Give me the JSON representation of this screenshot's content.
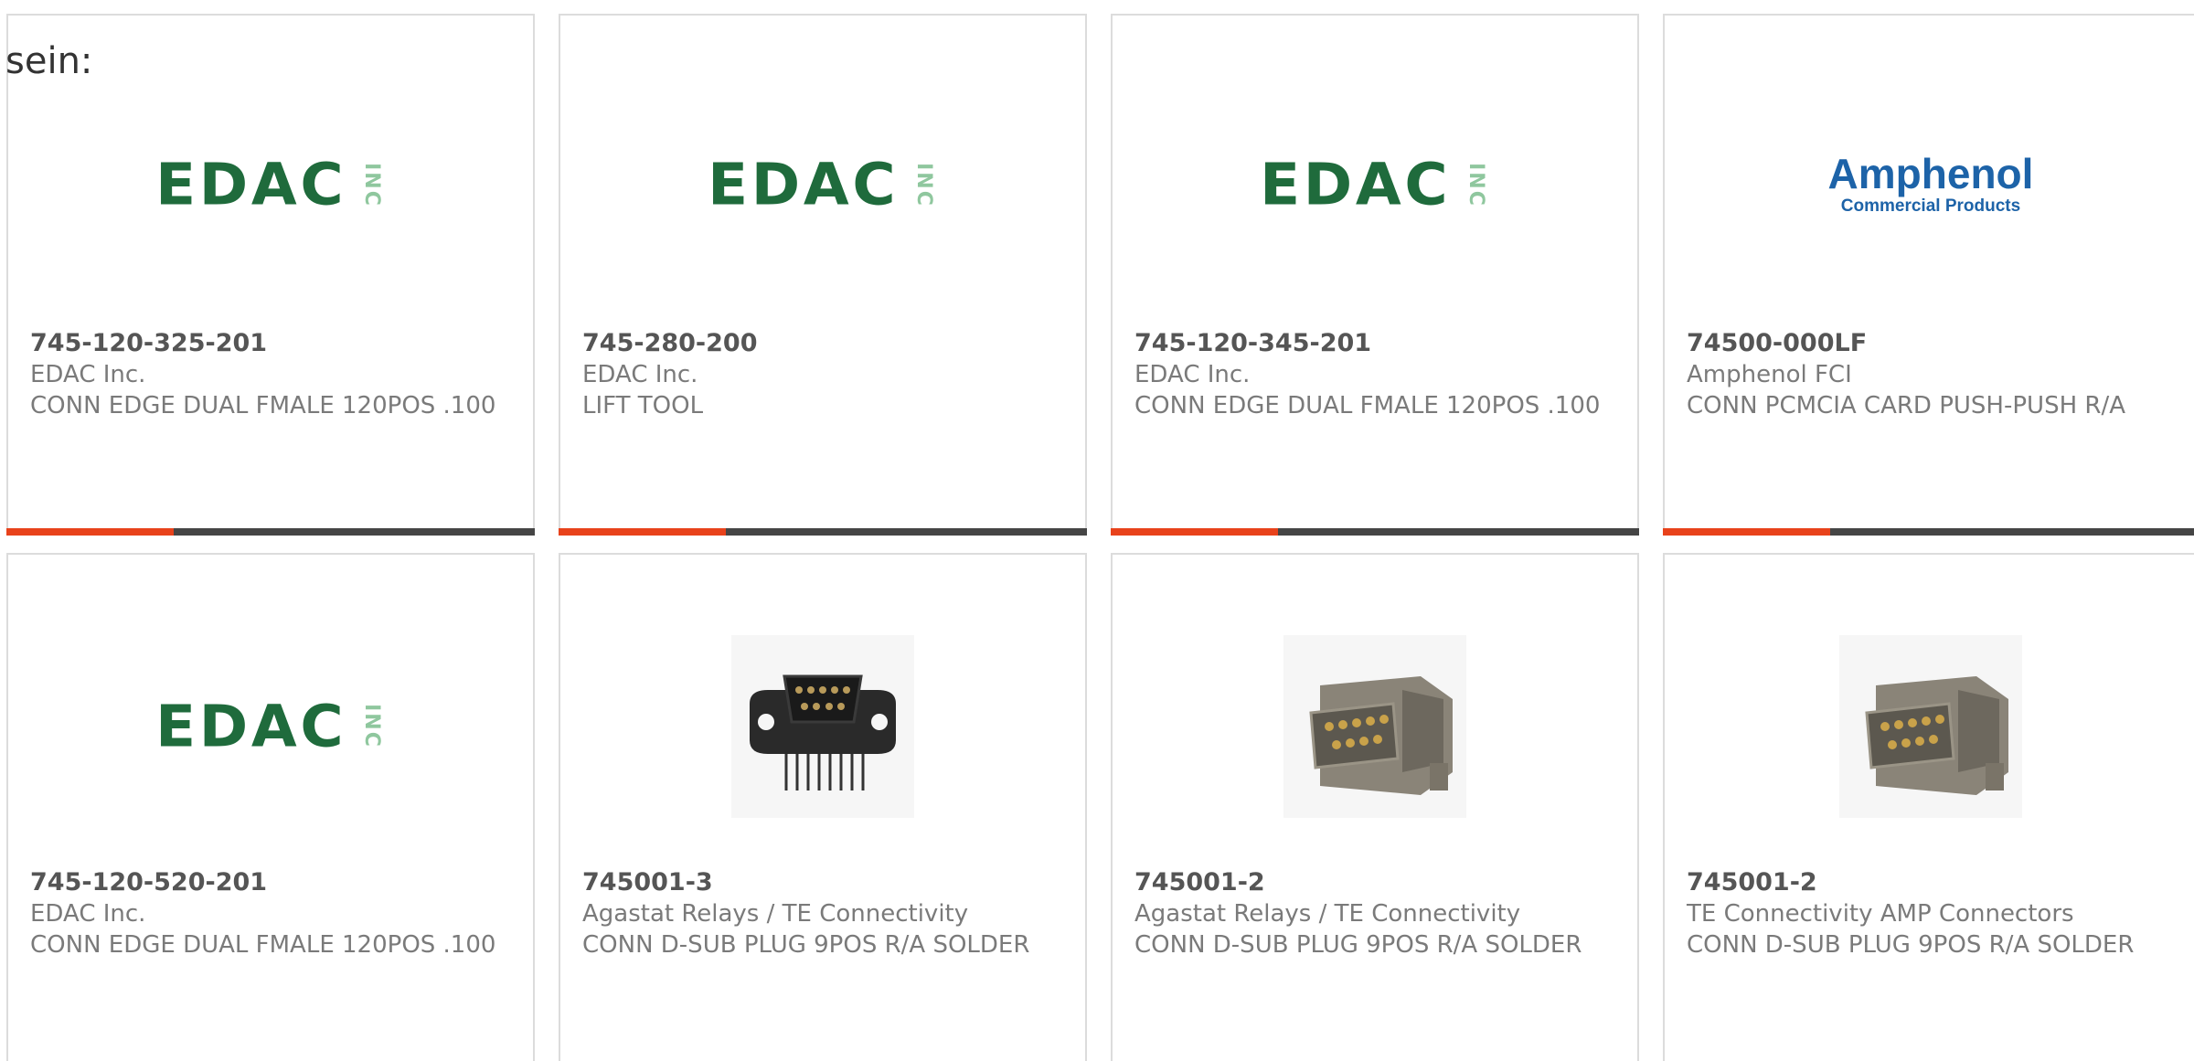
{
  "page": {
    "label": "sein:"
  },
  "products": [
    {
      "part_number": "745-120-325-201",
      "manufacturer": "EDAC Inc.",
      "description": "CONN EDGE DUAL FMALE 120POS .100",
      "image": "edac-logo"
    },
    {
      "part_number": "745-280-200",
      "manufacturer": "EDAC Inc.",
      "description": "LIFT TOOL",
      "image": "edac-logo"
    },
    {
      "part_number": "745-120-345-201",
      "manufacturer": "EDAC Inc.",
      "description": "CONN EDGE DUAL FMALE 120POS .100",
      "image": "edac-logo"
    },
    {
      "part_number": "74500-000LF",
      "manufacturer": "Amphenol FCI",
      "description": "CONN PCMCIA CARD PUSH-PUSH R/A",
      "image": "amphenol-logo"
    },
    {
      "part_number": "745-120-520-201",
      "manufacturer": "EDAC Inc.",
      "description": "CONN EDGE DUAL FMALE 120POS .100",
      "image": "edac-logo"
    },
    {
      "part_number": "745001-3",
      "manufacturer": "Agastat Relays / TE Connectivity",
      "description": "CONN D-SUB PLUG 9POS R/A SOLDER",
      "image": "dsub-black-photo"
    },
    {
      "part_number": "745001-2",
      "manufacturer": "Agastat Relays / TE Connectivity",
      "description": "CONN D-SUB PLUG 9POS R/A SOLDER",
      "image": "dsub-grey-photo"
    },
    {
      "part_number": "745001-2",
      "manufacturer": "TE Connectivity AMP Connectors",
      "description": "CONN D-SUB PLUG 9POS R/A SOLDER",
      "image": "dsub-grey-photo"
    }
  ],
  "logos": {
    "edac_text": "EDAC",
    "edac_inc": "INC",
    "amphenol_name": "Amphenol",
    "amphenol_sub": "Commercial Products"
  },
  "colors": {
    "accent": "#e8421b",
    "bar": "#454545",
    "edac_green": "#1f6b3c",
    "amphenol_blue": "#1d63a8"
  }
}
